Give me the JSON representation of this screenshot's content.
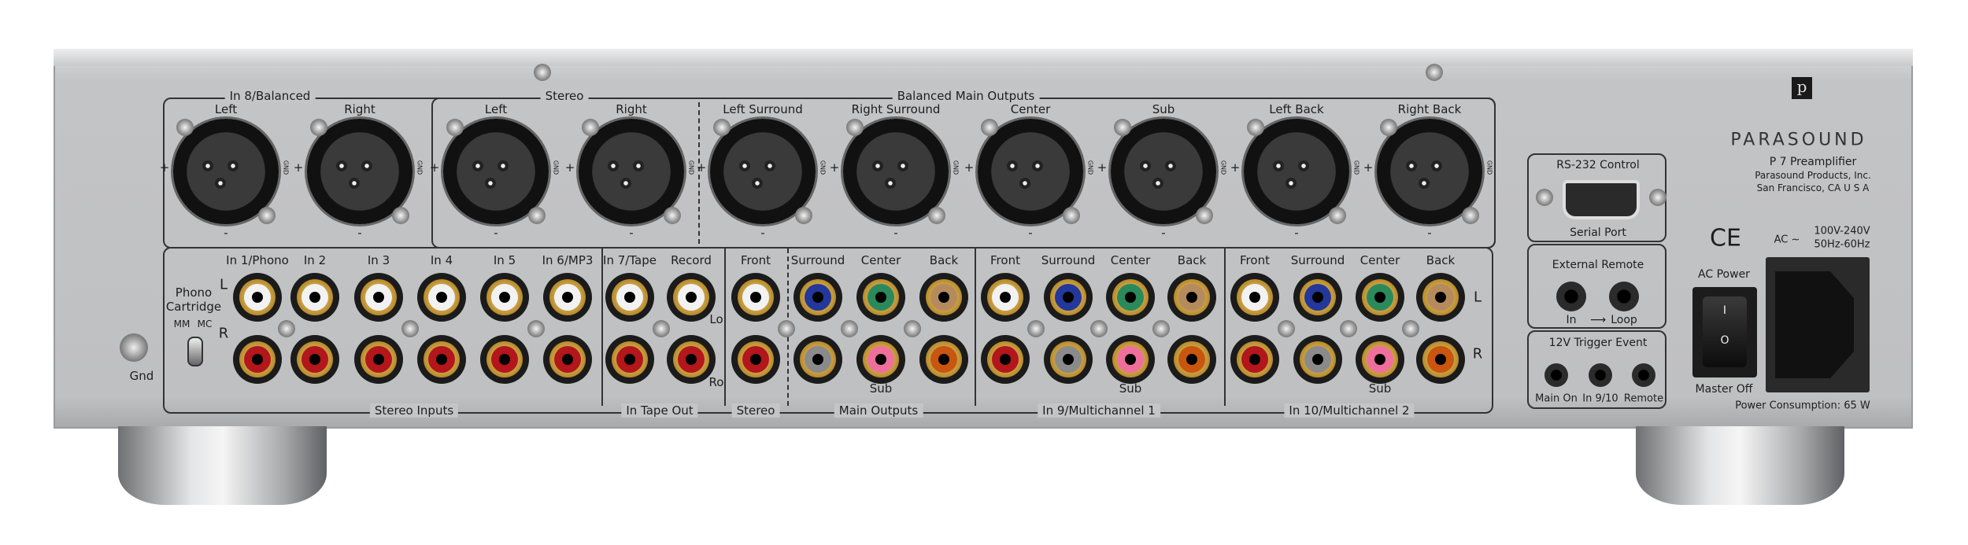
{
  "brand": {
    "logo_letter": "p",
    "name": "PARASOUND",
    "model": "P 7  Preamplifier",
    "company": "Parasound Products, Inc.",
    "location": "San Francisco, CA  U S A"
  },
  "balanced": {
    "groups": [
      "In 8/Balanced",
      "Stereo",
      "Balanced Main Outputs"
    ],
    "connectors": [
      "Left",
      "Right",
      "Left",
      "Right",
      "Left Surround",
      "Right Surround",
      "Center",
      "Sub",
      "Left Back",
      "Right Back"
    ],
    "plus": "+",
    "minus": "-",
    "gnd": "GND"
  },
  "rca": {
    "columns": [
      {
        "label": "In 1/Phono",
        "l": "#f2f2f2",
        "r": "#b3161b"
      },
      {
        "label": "In 2",
        "l": "#f2f2f2",
        "r": "#b3161b"
      },
      {
        "label": "In 3",
        "l": "#f2f2f2",
        "r": "#b3161b"
      },
      {
        "label": "In 4",
        "l": "#f2f2f2",
        "r": "#b3161b"
      },
      {
        "label": "In 5",
        "l": "#f2f2f2",
        "r": "#b3161b"
      },
      {
        "label": "In 6/MP3",
        "l": "#f2f2f2",
        "r": "#b3161b"
      },
      {
        "label": "In 7/Tape",
        "l": "#f2f2f2",
        "r": "#b3161b"
      },
      {
        "label": "Record",
        "l": "#f2f2f2",
        "r": "#b3161b"
      },
      {
        "label": "Front",
        "l": "#f2f2f2",
        "r": "#b3161b"
      },
      {
        "label": "Surround",
        "l": "#23389a",
        "r": "#8a8a8a"
      },
      {
        "label": "Center",
        "l": "#2a8a5c",
        "r": "#ef6f9c"
      },
      {
        "label": "Back",
        "l": "#b58b5e",
        "r": "#c9550f"
      },
      {
        "label": "Front",
        "l": "#f2f2f2",
        "r": "#b3161b"
      },
      {
        "label": "Surround",
        "l": "#23389a",
        "r": "#8a8a8a"
      },
      {
        "label": "Center",
        "l": "#2a8a5c",
        "r": "#ef6f9c"
      },
      {
        "label": "Back",
        "l": "#b58b5e",
        "r": "#c9550f"
      },
      {
        "label": "Front",
        "l": "#f2f2f2",
        "r": "#b3161b"
      },
      {
        "label": "Surround",
        "l": "#23389a",
        "r": "#8a8a8a"
      },
      {
        "label": "Center",
        "l": "#2a8a5c",
        "r": "#ef6f9c"
      },
      {
        "label": "Back",
        "l": "#b58b5e",
        "r": "#c9550f"
      }
    ],
    "groups": [
      "Stereo Inputs",
      "In   Tape   Out",
      "Stereo",
      "Main Outputs",
      "In 9/Multichannel 1",
      "In 10/Multichannel 2"
    ],
    "sub": "Sub",
    "L": "L",
    "R": "R",
    "Lo": "Lo",
    "Ro": "Ro",
    "phono": {
      "title1": "Phono",
      "title2": "Cartridge",
      "mm": "MM",
      "mc": "MC"
    },
    "gnd": "Gnd"
  },
  "control": {
    "rs232": {
      "title": "RS-232 Control",
      "port": "Serial Port"
    },
    "remote": {
      "title": "External Remote",
      "in": "In",
      "arrow": "⟶",
      "loop": "Loop"
    },
    "trigger": {
      "title": "12V Trigger Event",
      "jacks": [
        "Main On",
        "In 9/10",
        "Remote"
      ]
    }
  },
  "power": {
    "ce": "CE",
    "ac": "AC ~",
    "voltage": "100V-240V",
    "freq": "50Hz-60Hz",
    "switch_label": "AC Power",
    "on_symbol": "I",
    "off_symbol": "O",
    "master_off": "Master Off",
    "consumption": "Power Consumption: 65 W"
  }
}
